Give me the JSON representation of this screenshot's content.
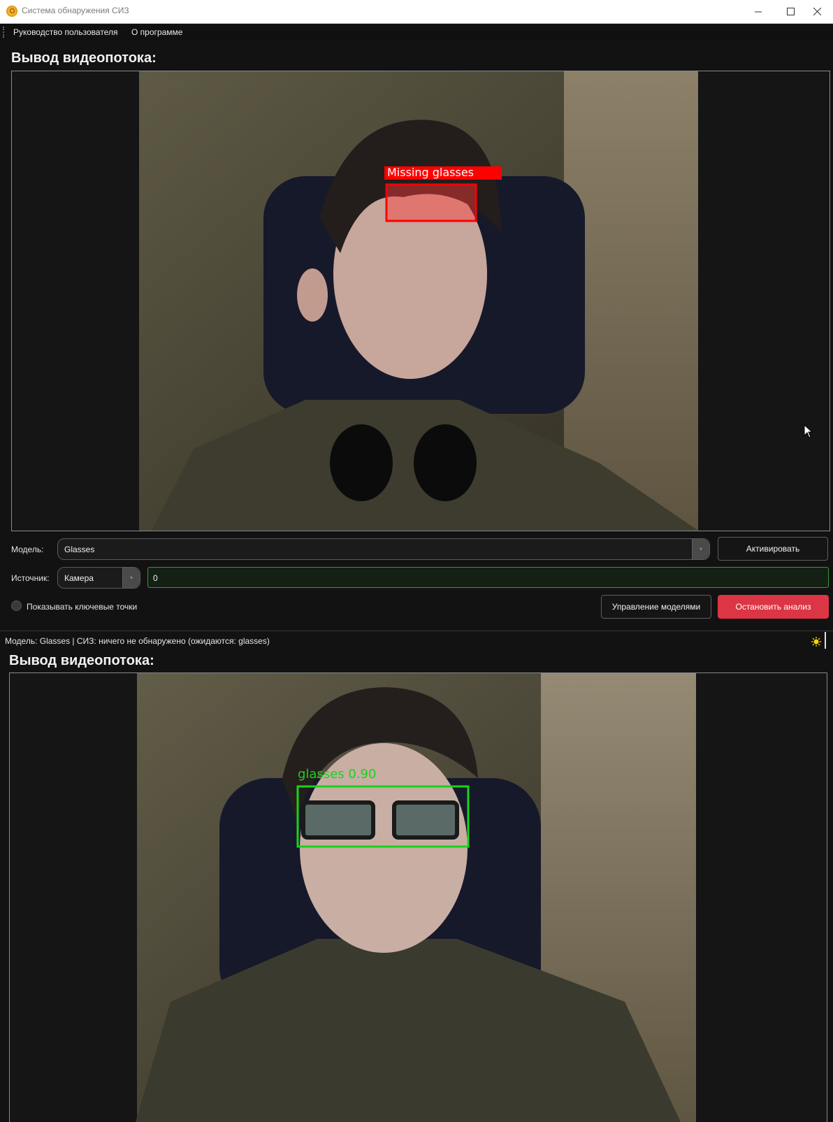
{
  "window": {
    "title": "Система обнаружения СИЗ"
  },
  "menu": {
    "items": [
      "Руководство пользователя",
      "О программе"
    ]
  },
  "panel_top": {
    "heading": "Вывод видеопотока:",
    "detection_label": "Missing glasses",
    "detection_color": "#ff0000"
  },
  "controls": {
    "model_label": "Модель:",
    "model_value": "Glasses",
    "activate_button": "Активировать",
    "source_label": "Источник:",
    "source_value": "Камера",
    "source_input_value": "0",
    "show_keypoints_label": "Показывать ключевые точки",
    "show_keypoints_checked": false,
    "manage_models_button": "Управление моделями",
    "stop_analysis_button": "Остановить анализ",
    "accent_danger": "#dc3545",
    "accent_input_border": "#2f9a3b"
  },
  "status": {
    "text": "Модель: Glasses | СИЗ: ничего не обнаружено (ожидаются: glasses)",
    "indicator_icon": "sun-icon",
    "indicator_color": "#ffd400"
  },
  "panel_bottom": {
    "heading": "Вывод видеопотока:",
    "detection_label": "glasses 0.90",
    "detection_color": "#19d21b"
  },
  "icons": {
    "app": "app-logo-icon",
    "minimize": "minimize-icon",
    "maximize": "maximize-icon",
    "close": "close-icon",
    "combo_arrow": "chevron-down-icon"
  }
}
